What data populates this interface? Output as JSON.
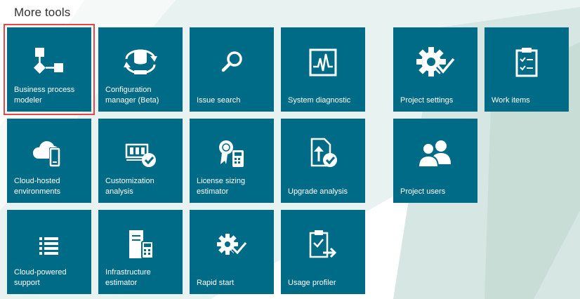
{
  "page_title": "More tools",
  "colors": {
    "tile_bg": "#006b87",
    "selection_border": "#e0484a",
    "title_text": "#333333"
  },
  "tiles": [
    {
      "label": "Business process\nmodeler",
      "icon": "flowchart-icon",
      "selected": true
    },
    {
      "label": "Configuration\nmanager (Beta)",
      "icon": "database-sync-icon"
    },
    {
      "label": "Issue search",
      "icon": "search-icon"
    },
    {
      "label": "System diagnostic",
      "icon": "pulse-monitor-icon"
    },
    {
      "label": "Project settings",
      "icon": "gear-check-icon"
    },
    {
      "label": "Work items",
      "icon": "clipboard-checklist-icon"
    },
    {
      "label": "Cloud-hosted\nenvironments",
      "icon": "cloud-device-icon"
    },
    {
      "label": "Customization\nanalysis",
      "icon": "component-check-icon"
    },
    {
      "label": "License sizing\nestimator",
      "icon": "certificate-calculator-icon"
    },
    {
      "label": "Upgrade analysis",
      "icon": "document-upload-check-icon"
    },
    {
      "label": "Project users",
      "icon": "users-icon"
    },
    {
      "label": "Cloud-powered\nsupport",
      "icon": "list-icon"
    },
    {
      "label": "Infrastructure\nestimator",
      "icon": "server-calculator-icon"
    },
    {
      "label": "Rapid start",
      "icon": "gear-check-small-icon"
    },
    {
      "label": "Usage profiler",
      "icon": "clipboard-arrow-icon"
    }
  ]
}
